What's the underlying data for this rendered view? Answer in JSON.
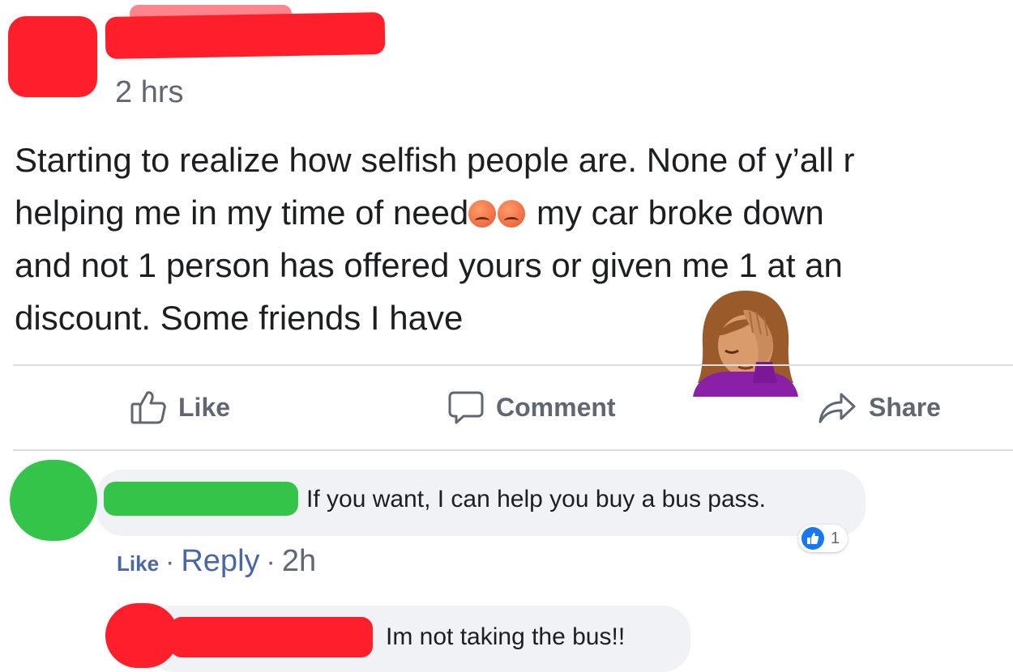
{
  "post": {
    "time": "2 hrs",
    "text_line1": "Starting to realize how selfish people are. None of y’all r",
    "text_line2_a": "helping me in my time of need",
    "text_line2_b": " my car broke down",
    "text_line3": "and not 1 person has offered yours or given me 1 at an",
    "text_line4": "discount. Some friends I have",
    "emojis": [
      "angry-face-icon",
      "angry-face-icon",
      "woman-facepalming-icon"
    ]
  },
  "actions": {
    "like_label": "Like",
    "comment_label": "Comment",
    "share_label": "Share"
  },
  "comments": [
    {
      "text": "If you want, I can help you buy a bus pass.",
      "like_label": "Like",
      "reply_label": "Reply",
      "time": "2h",
      "separator": "·",
      "reaction_count": "1"
    },
    {
      "text": "Im not taking the bus!!"
    }
  ],
  "colors": {
    "redaction_red": "#ff1f2b",
    "redaction_green": "#35c44a",
    "link_blue": "#4b67a1",
    "like_blue": "#1877f2"
  }
}
